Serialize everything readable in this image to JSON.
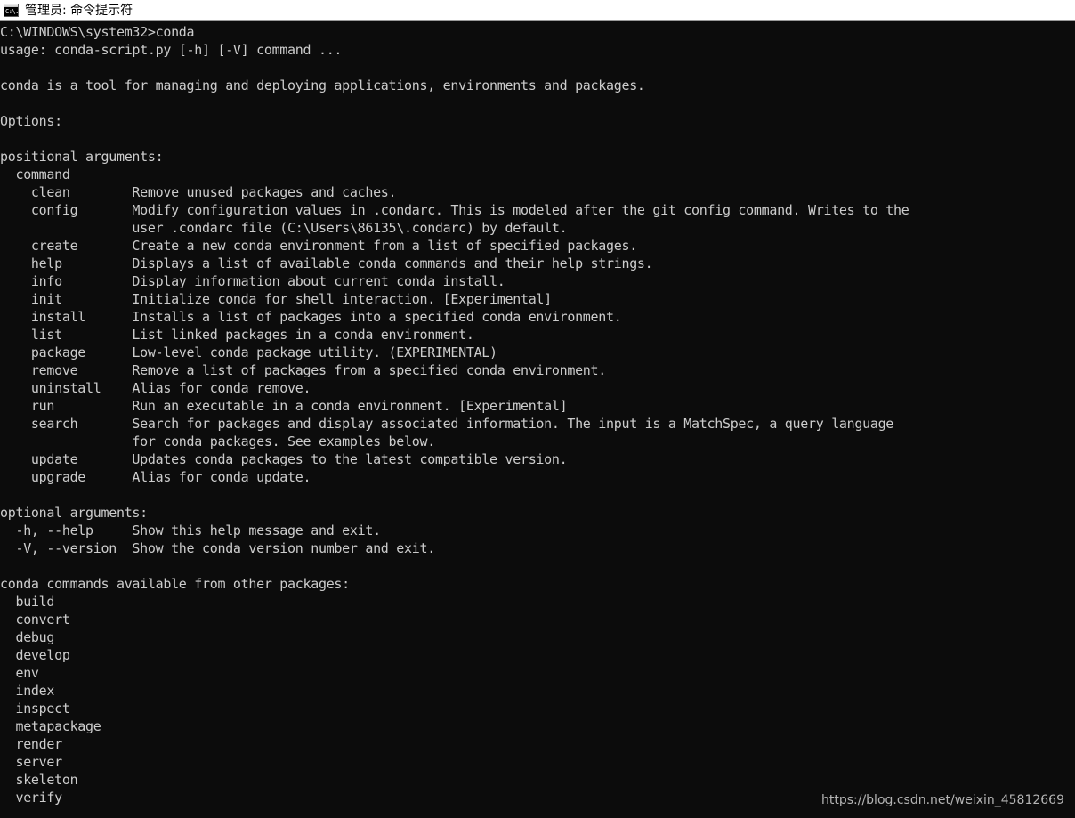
{
  "window": {
    "title": "管理员: 命令提示符",
    "icon": "command-prompt-icon",
    "icon_glyph": "C:\\.",
    "titlebar_bg": "#ffffff",
    "titlebar_text_color": "#000000"
  },
  "terminal": {
    "background_color": "#0c0c0c",
    "text_color": "#cccccc",
    "prompt": "C:\\WINDOWS\\system32>",
    "command": "conda",
    "lines": [
      "C:\\WINDOWS\\system32>conda",
      "usage: conda-script.py [-h] [-V] command ...",
      "",
      "conda is a tool for managing and deploying applications, environments and packages.",
      "",
      "Options:",
      "",
      "positional arguments:",
      "  command",
      "    clean        Remove unused packages and caches.",
      "    config       Modify configuration values in .condarc. This is modeled after the git config command. Writes to the",
      "                 user .condarc file (C:\\Users\\86135\\.condarc) by default.",
      "    create       Create a new conda environment from a list of specified packages.",
      "    help         Displays a list of available conda commands and their help strings.",
      "    info         Display information about current conda install.",
      "    init         Initialize conda for shell interaction. [Experimental]",
      "    install      Installs a list of packages into a specified conda environment.",
      "    list         List linked packages in a conda environment.",
      "    package      Low-level conda package utility. (EXPERIMENTAL)",
      "    remove       Remove a list of packages from a specified conda environment.",
      "    uninstall    Alias for conda remove.",
      "    run          Run an executable in a conda environment. [Experimental]",
      "    search       Search for packages and display associated information. The input is a MatchSpec, a query language",
      "                 for conda packages. See examples below.",
      "    update       Updates conda packages to the latest compatible version.",
      "    upgrade      Alias for conda update.",
      "",
      "optional arguments:",
      "  -h, --help     Show this help message and exit.",
      "  -V, --version  Show the conda version number and exit.",
      "",
      "conda commands available from other packages:",
      "  build",
      "  convert",
      "  debug",
      "  develop",
      "  env",
      "  index",
      "  inspect",
      "  metapackage",
      "  render",
      "  server",
      "  skeleton",
      "  verify"
    ],
    "usage_line": "usage: conda-script.py [-h] [-V] command ...",
    "description": "conda is a tool for managing and deploying applications, environments and packages.",
    "section_options": "Options:",
    "section_positional": "positional arguments:",
    "section_optional": "optional arguments:",
    "section_other_packages": "conda commands available from other packages:",
    "positional_commands": [
      {
        "name": "clean",
        "desc": "Remove unused packages and caches."
      },
      {
        "name": "config",
        "desc": "Modify configuration values in .condarc. This is modeled after the git config command. Writes to the user .condarc file (C:\\Users\\86135\\.condarc) by default."
      },
      {
        "name": "create",
        "desc": "Create a new conda environment from a list of specified packages."
      },
      {
        "name": "help",
        "desc": "Displays a list of available conda commands and their help strings."
      },
      {
        "name": "info",
        "desc": "Display information about current conda install."
      },
      {
        "name": "init",
        "desc": "Initialize conda for shell interaction. [Experimental]"
      },
      {
        "name": "install",
        "desc": "Installs a list of packages into a specified conda environment."
      },
      {
        "name": "list",
        "desc": "List linked packages in a conda environment."
      },
      {
        "name": "package",
        "desc": "Low-level conda package utility. (EXPERIMENTAL)"
      },
      {
        "name": "remove",
        "desc": "Remove a list of packages from a specified conda environment."
      },
      {
        "name": "uninstall",
        "desc": "Alias for conda remove."
      },
      {
        "name": "run",
        "desc": "Run an executable in a conda environment. [Experimental]"
      },
      {
        "name": "search",
        "desc": "Search for packages and display associated information. The input is a MatchSpec, a query language for conda packages. See examples below."
      },
      {
        "name": "update",
        "desc": "Updates conda packages to the latest compatible version."
      },
      {
        "name": "upgrade",
        "desc": "Alias for conda update."
      }
    ],
    "optional_arguments": [
      {
        "flags": "-h, --help",
        "desc": "Show this help message and exit."
      },
      {
        "flags": "-V, --version",
        "desc": "Show the conda version number and exit."
      }
    ],
    "other_package_commands": [
      "build",
      "convert",
      "debug",
      "develop",
      "env",
      "index",
      "inspect",
      "metapackage",
      "render",
      "server",
      "skeleton",
      "verify"
    ]
  },
  "watermark": {
    "text": "https://blog.csdn.net/weixin_45812669",
    "color": "#b4b4b4"
  }
}
